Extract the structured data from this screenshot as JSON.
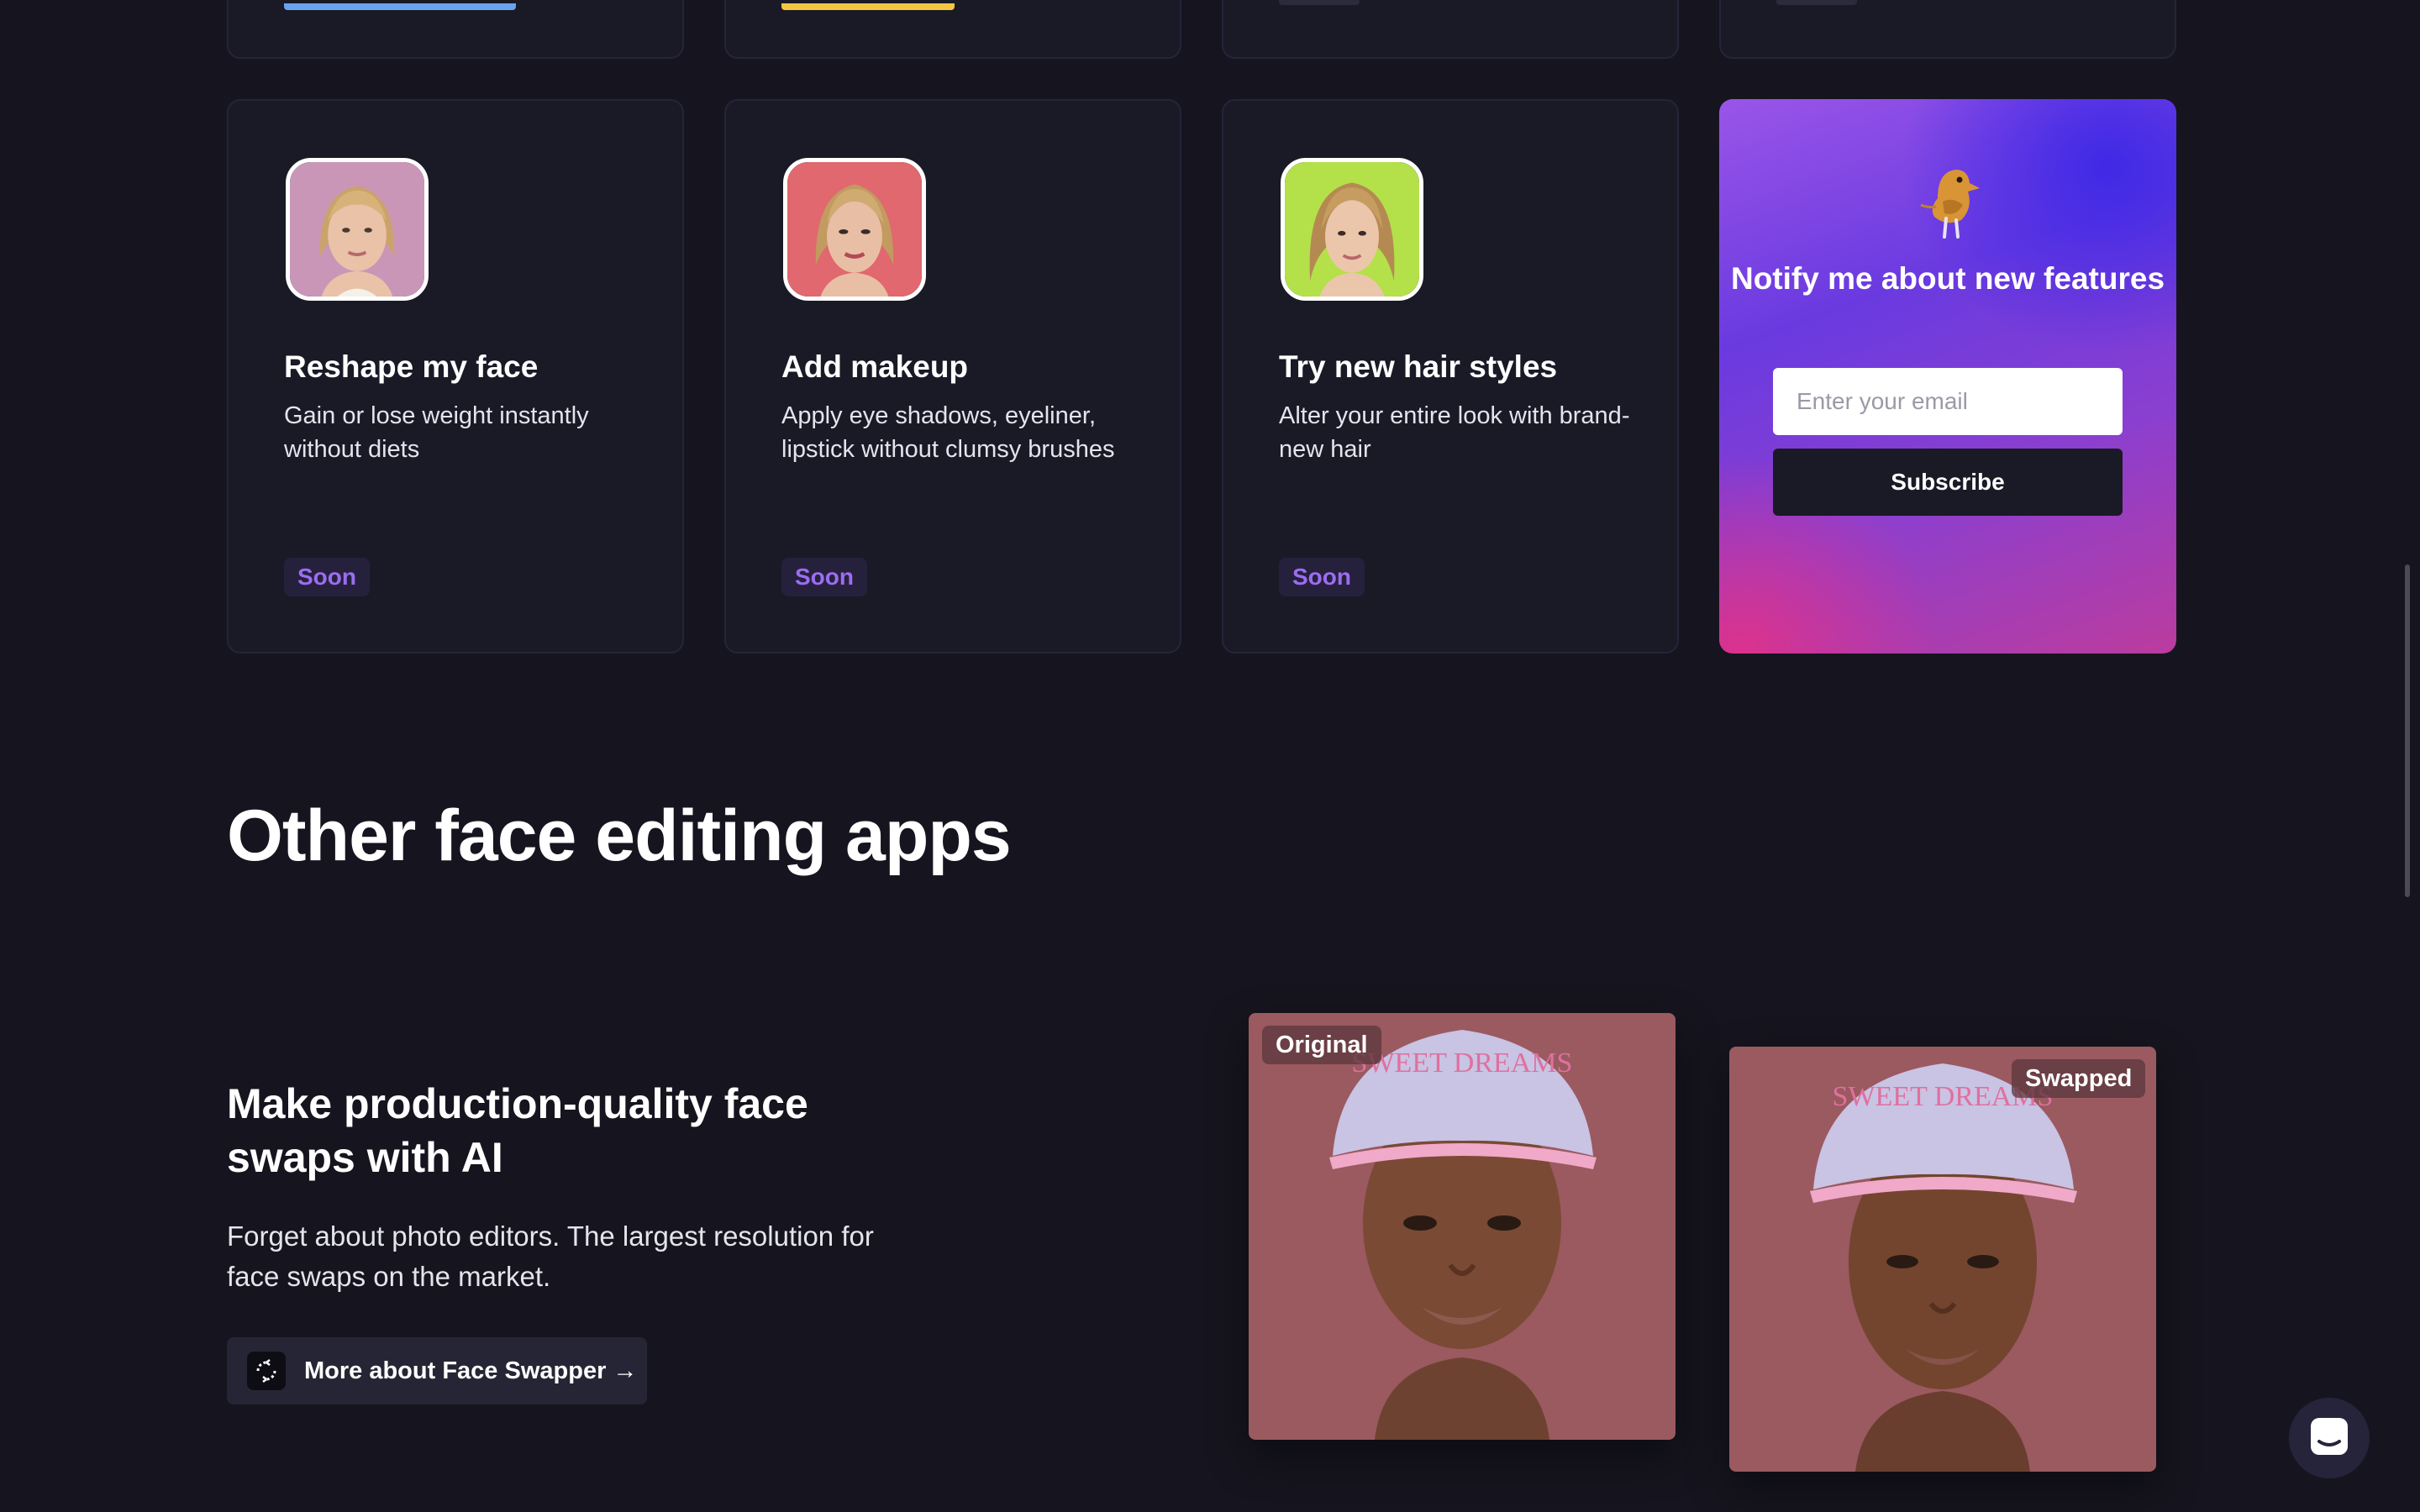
{
  "top_cards": [
    {
      "accent": "#6aa3f0"
    },
    {
      "accent": "#f4c542"
    },
    {
      "accent": "#35343f"
    },
    {
      "accent": "#35343f"
    }
  ],
  "feature_cards": [
    {
      "title": "Reshape my face",
      "description": "Gain or lose weight instantly without diets",
      "badge": "Soon",
      "avatar_bg": "#c996b8"
    },
    {
      "title": "Add makeup",
      "description": "Apply eye shadows, eyeliner, lipstick without clumsy brushes",
      "badge": "Soon",
      "avatar_bg": "#e0686e"
    },
    {
      "title": "Try new hair styles",
      "description": "Alter your entire look with brand-new hair",
      "badge": "Soon",
      "avatar_bg": "#b4e04a"
    }
  ],
  "notify": {
    "title": "Notify me about new features",
    "email_placeholder": "Enter your email",
    "email_value": "",
    "subscribe_label": "Subscribe",
    "icon": "bird-icon"
  },
  "other_apps": {
    "heading": "Other face editing apps",
    "face_swapper": {
      "title": "Make production-quality face swaps with AI",
      "description": "Forget about photo editors. The largest resolution for face swaps on the market.",
      "link_label": "More about Face Swapper →",
      "original_label": "Original",
      "swapped_label": "Swapped"
    }
  },
  "colors": {
    "background": "#16151f",
    "card": "#1a1926",
    "badge_text": "#9c6df0",
    "photo_bg": "#9a5a60"
  }
}
